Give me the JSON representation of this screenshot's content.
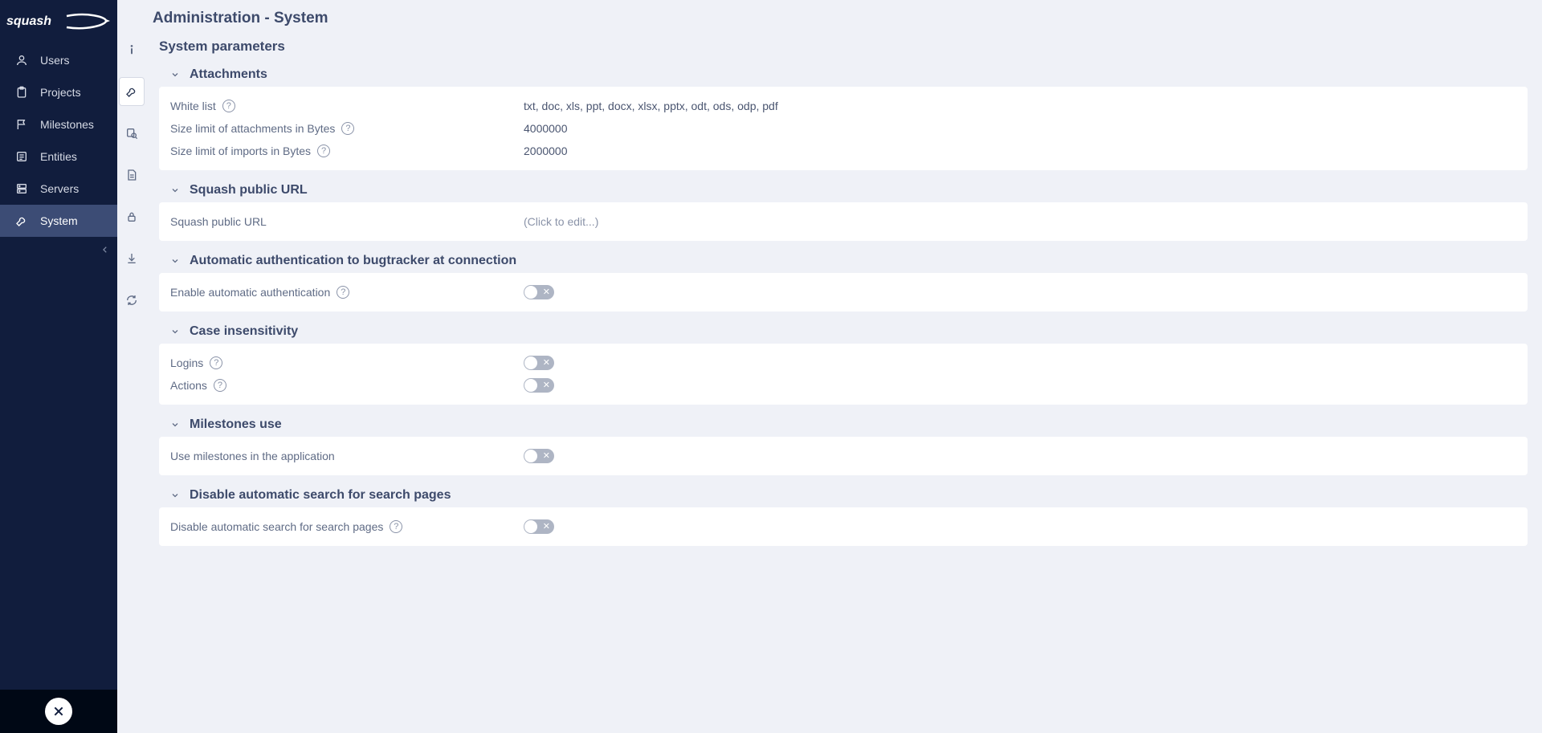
{
  "brand": "squash",
  "sidebar": {
    "items": [
      {
        "label": "Users",
        "icon": "user-icon"
      },
      {
        "label": "Projects",
        "icon": "clipboard-icon"
      },
      {
        "label": "Milestones",
        "icon": "flag-icon"
      },
      {
        "label": "Entities",
        "icon": "list-icon"
      },
      {
        "label": "Servers",
        "icon": "server-icon"
      },
      {
        "label": "System",
        "icon": "wrench-icon"
      }
    ]
  },
  "rail": {
    "items": [
      {
        "name": "info-icon"
      },
      {
        "name": "wrench-icon"
      },
      {
        "name": "inspect-icon"
      },
      {
        "name": "document-icon"
      },
      {
        "name": "lock-icon"
      },
      {
        "name": "download-icon"
      },
      {
        "name": "sync-icon"
      }
    ],
    "active_index": 1
  },
  "page": {
    "title": "Administration - System",
    "subtitle": "System parameters"
  },
  "sections": {
    "attachments": {
      "heading": "Attachments",
      "rows": {
        "white_list": {
          "label": "White list",
          "value": "txt, doc, xls, ppt, docx, xlsx, pptx, odt, ods, odp, pdf",
          "help": true
        },
        "size_attach": {
          "label": "Size limit of attachments in Bytes",
          "value": "4000000",
          "help": true
        },
        "size_import": {
          "label": "Size limit of imports in Bytes",
          "value": "2000000",
          "help": true
        }
      }
    },
    "public_url": {
      "heading": "Squash public URL",
      "rows": {
        "url": {
          "label": "Squash public URL",
          "placeholder": "(Click to edit...)"
        }
      }
    },
    "auto_auth": {
      "heading": "Automatic authentication to bugtracker at connection",
      "rows": {
        "enable": {
          "label": "Enable automatic authentication",
          "help": true,
          "toggle": false
        }
      }
    },
    "case_insensitivity": {
      "heading": "Case insensitivity",
      "rows": {
        "logins": {
          "label": "Logins",
          "help": true,
          "toggle": false
        },
        "actions": {
          "label": "Actions",
          "help": true,
          "toggle": false
        }
      }
    },
    "milestones_use": {
      "heading": "Milestones use",
      "rows": {
        "use": {
          "label": "Use milestones in the application",
          "toggle": false
        }
      }
    },
    "disable_search": {
      "heading": "Disable automatic search for search pages",
      "rows": {
        "disable": {
          "label": "Disable automatic search for search pages",
          "help": true,
          "toggle": false
        }
      }
    }
  }
}
